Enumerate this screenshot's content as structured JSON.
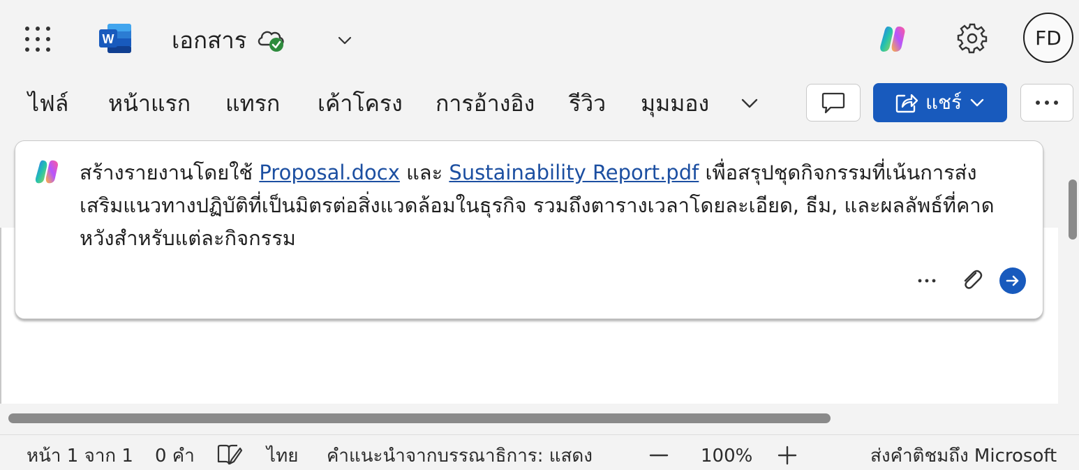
{
  "app": {
    "document_title": "เอกสาร",
    "user_initials": "FD",
    "icons": [
      "app-launcher-icon",
      "word-logo-icon",
      "cloud-saved-icon",
      "chevron-down-icon",
      "copilot-icon",
      "gear-icon"
    ]
  },
  "ribbon": {
    "tabs": [
      {
        "label": "ไฟล์"
      },
      {
        "label": "หน้าแรก"
      },
      {
        "label": "แทรก"
      },
      {
        "label": "เค้าโครง"
      },
      {
        "label": "การอ้างอิง"
      },
      {
        "label": "รีวิว"
      },
      {
        "label": "มุมมอง"
      }
    ],
    "share_label": "แชร์",
    "icons": [
      "comment-icon",
      "share-icon",
      "more-icon"
    ]
  },
  "copilot_prompt": {
    "text_part1": "สร้างรายงานโดยใช้ ",
    "file1": "Proposal.docx",
    "text_part2": " และ ",
    "file2": "Sustainability Report.pdf",
    "text_part3": " เพื่อสรุปชุดกิจกรรมที่เน้นการส่งเสริมแนวทางปฏิบัติที่เป็นมิตรต่อสิ่งแวดล้อมในธุรกิจ รวมถึงตารางเวลาโดยละเอียด, ธีม, และผลลัพธ์ที่คาดหวังสำหรับแต่ละกิจกรรม",
    "icons": [
      "more-options-icon",
      "attach-icon",
      "send-arrow-icon"
    ]
  },
  "status_bar": {
    "page": "หน้า 1 จาก 1",
    "words": "0 คำ",
    "language": "ไทย",
    "editor_suggestions": "คำแนะนำจากบรรณาธิการ: แสดง",
    "zoom": "100%",
    "feedback": "ส่งคำติชมถึง Microsoft"
  },
  "colors": {
    "accent": "#185abd",
    "link": "#1c4fa1",
    "background": "#f3f3f3",
    "canvas": "#ffffff"
  }
}
